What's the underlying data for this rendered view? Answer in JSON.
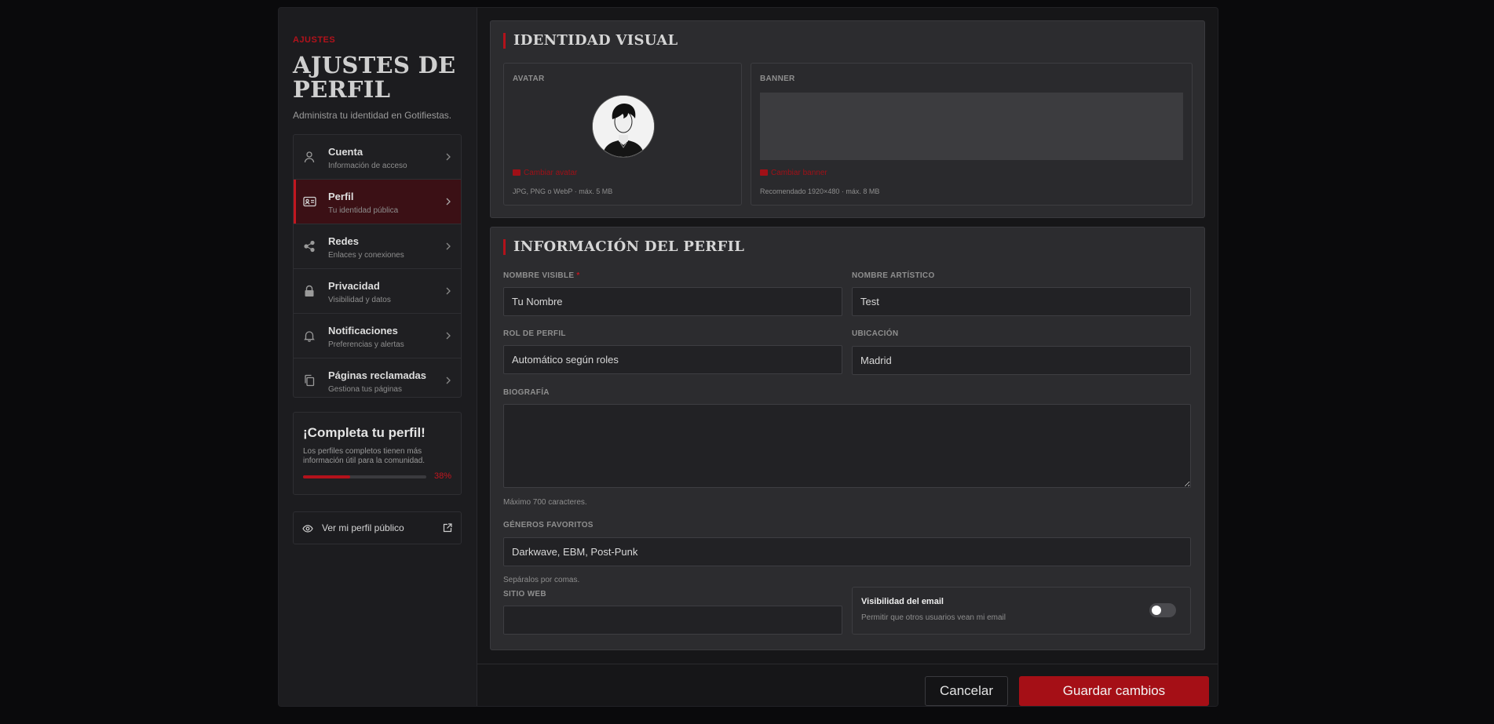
{
  "sidebar": {
    "eyebrow": "AJUSTES",
    "title": "AJUSTES DE PERFIL",
    "subtitle": "Administra tu identidad en Gotifiestas.",
    "items": [
      {
        "label": "Cuenta",
        "desc": "Información de acceso",
        "icon": "user-icon",
        "active": false
      },
      {
        "label": "Perfil",
        "desc": "Tu identidad pública",
        "icon": "id-card-icon",
        "active": true
      },
      {
        "label": "Redes",
        "desc": "Enlaces y conexiones",
        "icon": "share-icon",
        "active": false
      },
      {
        "label": "Privacidad",
        "desc": "Visibilidad y datos",
        "icon": "lock-icon",
        "active": false
      },
      {
        "label": "Notificaciones",
        "desc": "Preferencias y alertas",
        "icon": "bell-icon",
        "active": false
      },
      {
        "label": "Páginas reclamadas",
        "desc": "Gestiona tus páginas",
        "icon": "copy-icon",
        "active": false
      }
    ],
    "complete": {
      "title": "¡Completa tu perfil!",
      "text": "Los perfiles completos tienen más información útil para la comunidad.",
      "progress": 38,
      "progress_label": "38%"
    },
    "public_link": "Ver mi perfil público"
  },
  "identity": {
    "title": "IDENTIDAD VISUAL",
    "avatar": {
      "label": "AVATAR",
      "change": "Cambiar avatar",
      "hint": "JPG, PNG o WebP · máx. 5 MB"
    },
    "banner": {
      "label": "BANNER",
      "change": "Cambiar banner",
      "hint": "Recomendado 1920×480 · máx. 8 MB"
    }
  },
  "info": {
    "title": "INFORMACIÓN DEL PERFIL",
    "display_name": {
      "label": "NOMBRE VISIBLE",
      "required": "*",
      "value": "Tu Nombre"
    },
    "artist_name": {
      "label": "NOMBRE ARTÍSTICO",
      "value": "Test"
    },
    "role": {
      "label": "ROL DE PERFIL",
      "value": "Automático según roles"
    },
    "location": {
      "label": "UBICACIÓN",
      "value": "Madrid"
    },
    "bio": {
      "label": "BIOGRAFÍA",
      "value": "",
      "help": "Máximo 700 caracteres."
    },
    "genres": {
      "label": "GÉNEROS FAVORITOS",
      "value": "Darkwave, EBM, Post-Punk",
      "help": "Sepáralos por comas."
    },
    "website": {
      "label": "SITIO WEB",
      "value": ""
    },
    "email_visibility": {
      "title": "Visibilidad del email",
      "desc": "Permitir que otros usuarios vean mi email",
      "enabled": false
    }
  },
  "footer": {
    "cancel": "Cancelar",
    "save": "Guardar cambios"
  },
  "colors": {
    "accent": "#b3121b",
    "active_bg": "#3b1015",
    "save_button": "#a50f16"
  }
}
